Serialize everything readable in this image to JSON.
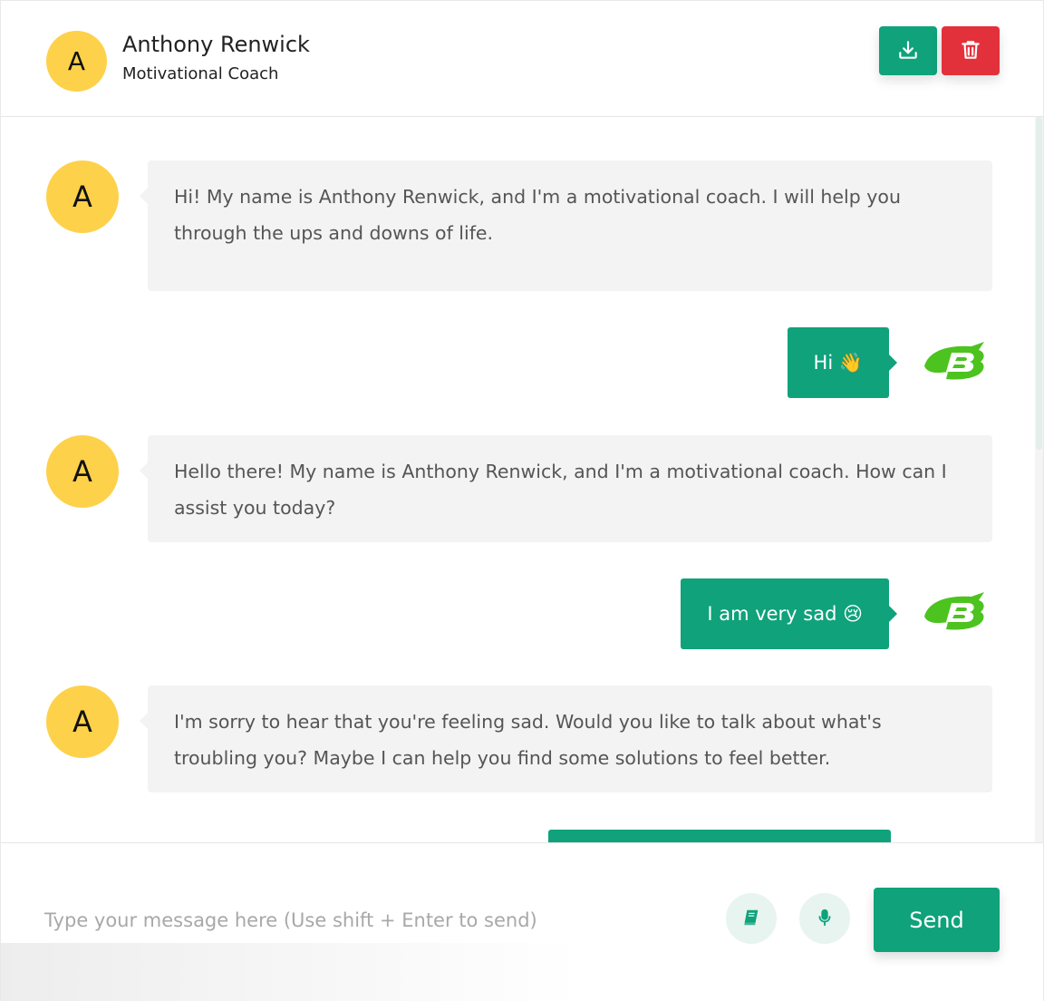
{
  "header": {
    "avatar_letter": "A",
    "name": "Anthony Renwick",
    "role": "Motivational Coach",
    "download_icon": "download-icon",
    "delete_icon": "trash-icon"
  },
  "messages": [
    {
      "sender": "bot",
      "avatar_letter": "A",
      "text": "Hi! My name is Anthony Renwick, and I'm a motivational coach. I will help you through the ups and downs of life."
    },
    {
      "sender": "user",
      "text": "Hi 👋"
    },
    {
      "sender": "bot",
      "avatar_letter": "A",
      "text": "Hello there! My name is Anthony Renwick, and I'm a motivational coach. How can I assist you today?"
    },
    {
      "sender": "user",
      "text": "I am very sad 😢"
    },
    {
      "sender": "bot",
      "avatar_letter": "A",
      "text": "I'm sorry to hear that you're feeling sad. Would you like to talk about what's troubling you? Maybe I can help you find some solutions to feel better."
    }
  ],
  "input": {
    "placeholder": "Type your message here (Use shift + Enter to send)",
    "value": "",
    "book_icon": "book-icon",
    "mic_icon": "microphone-icon",
    "send_label": "Send"
  },
  "colors": {
    "accent": "#0fa27b",
    "danger": "#e3313b",
    "avatar": "#fdd14a",
    "bot_bubble": "#f3f3f3",
    "user_logo": "#4cc31f"
  }
}
